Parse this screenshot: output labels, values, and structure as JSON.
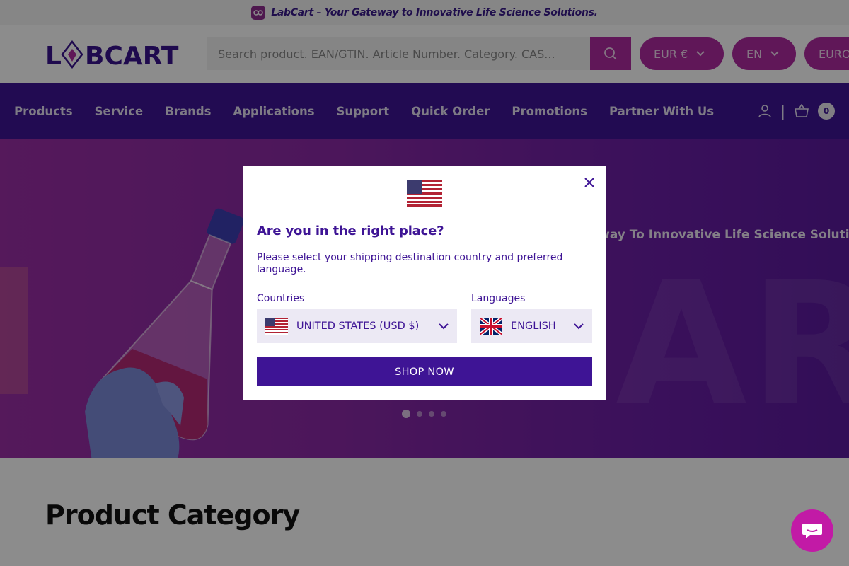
{
  "announcement": {
    "text": "LabCart – Your Gateway to Innovative Life Science Solutions."
  },
  "header": {
    "logo_text": "LABCART",
    "search_placeholder": "Search product. EAN/GTIN. Article Number. Category. CAS...",
    "currency_label": "EUR €",
    "language_label": "EN",
    "region_label": "EURO",
    "accent_color": "#b02aa0"
  },
  "nav": {
    "items": [
      "Products",
      "Service",
      "Brands",
      "Applications",
      "Support",
      "Quick Order",
      "Promotions",
      "Partner With Us"
    ],
    "separator": "|",
    "cart_count": "0",
    "background_color": "#3e1495"
  },
  "hero": {
    "tagline": "ateway To Innovative Life Science Solutions",
    "background_word": "ARTI",
    "slides": 4,
    "active_slide": 1
  },
  "section": {
    "title": "Product Category"
  },
  "modal": {
    "title": "Are you in the right place?",
    "description": "Please select your shipping destination country and preferred language.",
    "countries_label": "Countries",
    "languages_label": "Languages",
    "country_value": "UNITED STATES (USD $)",
    "language_value": "ENGLISH",
    "shop_button": "SHOP NOW",
    "primary_color": "#3e1495"
  },
  "icons": {
    "announcement": "logo-badge-icon",
    "search": "search-icon",
    "account": "user-icon",
    "cart": "basket-icon",
    "close": "close-icon",
    "chat": "chat-icon",
    "dropdown": "chevron-down-icon"
  }
}
